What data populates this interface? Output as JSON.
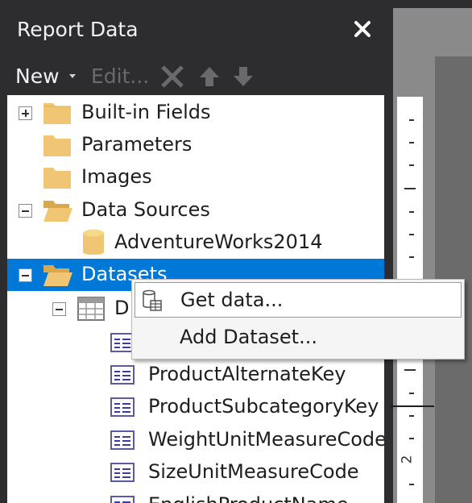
{
  "panel": {
    "title": "Report Data",
    "toolbar": {
      "new_label": "New",
      "edit_label": "Edit...",
      "delete_icon": "x-icon",
      "move_up_icon": "arrow-up-icon",
      "move_down_icon": "arrow-down-icon"
    }
  },
  "tree": {
    "items": [
      {
        "label": "Built-in Fields",
        "expander": "plus",
        "icon": "folder-icon"
      },
      {
        "label": "Parameters",
        "expander": "none",
        "icon": "folder-icon"
      },
      {
        "label": "Images",
        "expander": "none",
        "icon": "folder-icon"
      },
      {
        "label": "Data Sources",
        "expander": "minus",
        "icon": "folder-open-icon"
      },
      {
        "label": "AdventureWorks2014",
        "expander": "none",
        "icon": "database-icon"
      },
      {
        "label": "Datasets",
        "expander": "minus",
        "icon": "folder-open-icon",
        "selected": true
      },
      {
        "label": "D",
        "expander": "minus",
        "icon": "table-icon"
      },
      {
        "label": "ProductAlternateKey",
        "icon": "field-icon"
      },
      {
        "label": "ProductSubcategoryKey",
        "icon": "field-icon"
      },
      {
        "label": "WeightUnitMeasureCode",
        "icon": "field-icon"
      },
      {
        "label": "SizeUnitMeasureCode",
        "icon": "field-icon"
      },
      {
        "label": "EnglishProductName",
        "icon": "field-icon"
      }
    ]
  },
  "context_menu": {
    "items": [
      {
        "label": "Get data...",
        "icon": "get-data-icon"
      },
      {
        "label": "Add Dataset...",
        "icon": ""
      }
    ]
  },
  "ruler": {
    "label": "2"
  },
  "colors": {
    "panel_bg": "#2d2d30",
    "selection": "#0078d7",
    "folder": "#f0c674"
  }
}
